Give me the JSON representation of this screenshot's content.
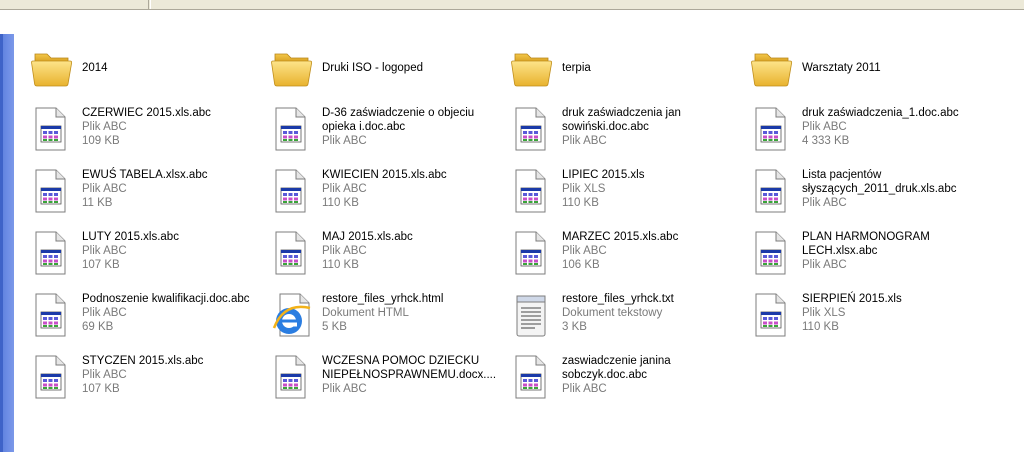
{
  "items": [
    {
      "kind": "folder",
      "name": "2014"
    },
    {
      "kind": "folder",
      "name": "Druki ISO - logoped"
    },
    {
      "kind": "folder",
      "name": "terpia"
    },
    {
      "kind": "folder",
      "name": "Warsztaty 2011"
    },
    {
      "kind": "abc",
      "name": "CZERWIEC 2015.xls.abc",
      "type": "Plik ABC",
      "size": "109 KB"
    },
    {
      "kind": "abc",
      "name": "D-36 zaświadczenie o objeciu",
      "name2": "opieka i.doc.abc",
      "type": "Plik ABC"
    },
    {
      "kind": "abc",
      "name": "druk zaświadczenia jan",
      "name2": "sowiński.doc.abc",
      "type": "Plik ABC"
    },
    {
      "kind": "abc",
      "name": "druk zaświadczenia_1.doc.abc",
      "type": "Plik ABC",
      "size": "4 333 KB"
    },
    {
      "kind": "abc",
      "name": "EWUŚ TABELA.xlsx.abc",
      "type": "Plik ABC",
      "size": "11 KB"
    },
    {
      "kind": "abc",
      "name": "KWIECIEN 2015.xls.abc",
      "type": "Plik ABC",
      "size": "110 KB"
    },
    {
      "kind": "abc",
      "name": "LIPIEC 2015.xls",
      "type": "Plik XLS",
      "size": "110 KB"
    },
    {
      "kind": "abc",
      "name": "Lista pacjentów",
      "name2": "słyszących_2011_druk.xls.abc",
      "type": "Plik ABC"
    },
    {
      "kind": "abc",
      "name": "LUTY 2015.xls.abc",
      "type": "Plik ABC",
      "size": "107 KB"
    },
    {
      "kind": "abc",
      "name": "MAJ 2015.xls.abc",
      "type": "Plik ABC",
      "size": "110 KB"
    },
    {
      "kind": "abc",
      "name": "MARZEC 2015.xls.abc",
      "type": "Plik ABC",
      "size": "106 KB"
    },
    {
      "kind": "abc",
      "name": "PLAN HARMONOGRAM",
      "name2": "LECH.xlsx.abc",
      "type": "Plik ABC"
    },
    {
      "kind": "abc",
      "name": "Podnoszenie kwalifikacji.doc.abc",
      "type": "Plik ABC",
      "size": "69 KB"
    },
    {
      "kind": "html",
      "name": "restore_files_yrhck.html",
      "type": "Dokument HTML",
      "size": "5 KB"
    },
    {
      "kind": "txt",
      "name": "restore_files_yrhck.txt",
      "type": "Dokument tekstowy",
      "size": "3 KB"
    },
    {
      "kind": "abc",
      "name": "SIERPIEŃ 2015.xls",
      "type": "Plik XLS",
      "size": "110 KB"
    },
    {
      "kind": "abc",
      "name": "STYCZEN 2015.xls.abc",
      "type": "Plik ABC",
      "size": "107 KB"
    },
    {
      "kind": "abc",
      "name": "WCZESNA POMOC DZIECKU",
      "name2": "NIEPEŁNOSPRAWNEMU.docx....",
      "type": "Plik ABC"
    },
    {
      "kind": "abc",
      "name": "zaswiadczenie janina",
      "name2": "sobczyk.doc.abc",
      "type": "Plik ABC"
    }
  ],
  "colors": {
    "folder": "#f5c842",
    "sidebar": "#6f8fe6",
    "meta_text": "#7a7a7a"
  }
}
